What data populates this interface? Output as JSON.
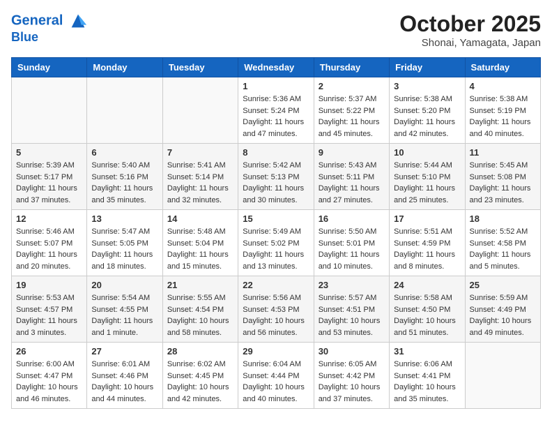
{
  "header": {
    "logo_line1": "General",
    "logo_line2": "Blue",
    "title": "October 2025",
    "subtitle": "Shonai, Yamagata, Japan"
  },
  "calendar": {
    "weekdays": [
      "Sunday",
      "Monday",
      "Tuesday",
      "Wednesday",
      "Thursday",
      "Friday",
      "Saturday"
    ],
    "rows": [
      [
        {
          "day": "",
          "info": ""
        },
        {
          "day": "",
          "info": ""
        },
        {
          "day": "",
          "info": ""
        },
        {
          "day": "1",
          "info": "Sunrise: 5:36 AM\nSunset: 5:24 PM\nDaylight: 11 hours and 47 minutes."
        },
        {
          "day": "2",
          "info": "Sunrise: 5:37 AM\nSunset: 5:22 PM\nDaylight: 11 hours and 45 minutes."
        },
        {
          "day": "3",
          "info": "Sunrise: 5:38 AM\nSunset: 5:20 PM\nDaylight: 11 hours and 42 minutes."
        },
        {
          "day": "4",
          "info": "Sunrise: 5:38 AM\nSunset: 5:19 PM\nDaylight: 11 hours and 40 minutes."
        }
      ],
      [
        {
          "day": "5",
          "info": "Sunrise: 5:39 AM\nSunset: 5:17 PM\nDaylight: 11 hours and 37 minutes."
        },
        {
          "day": "6",
          "info": "Sunrise: 5:40 AM\nSunset: 5:16 PM\nDaylight: 11 hours and 35 minutes."
        },
        {
          "day": "7",
          "info": "Sunrise: 5:41 AM\nSunset: 5:14 PM\nDaylight: 11 hours and 32 minutes."
        },
        {
          "day": "8",
          "info": "Sunrise: 5:42 AM\nSunset: 5:13 PM\nDaylight: 11 hours and 30 minutes."
        },
        {
          "day": "9",
          "info": "Sunrise: 5:43 AM\nSunset: 5:11 PM\nDaylight: 11 hours and 27 minutes."
        },
        {
          "day": "10",
          "info": "Sunrise: 5:44 AM\nSunset: 5:10 PM\nDaylight: 11 hours and 25 minutes."
        },
        {
          "day": "11",
          "info": "Sunrise: 5:45 AM\nSunset: 5:08 PM\nDaylight: 11 hours and 23 minutes."
        }
      ],
      [
        {
          "day": "12",
          "info": "Sunrise: 5:46 AM\nSunset: 5:07 PM\nDaylight: 11 hours and 20 minutes."
        },
        {
          "day": "13",
          "info": "Sunrise: 5:47 AM\nSunset: 5:05 PM\nDaylight: 11 hours and 18 minutes."
        },
        {
          "day": "14",
          "info": "Sunrise: 5:48 AM\nSunset: 5:04 PM\nDaylight: 11 hours and 15 minutes."
        },
        {
          "day": "15",
          "info": "Sunrise: 5:49 AM\nSunset: 5:02 PM\nDaylight: 11 hours and 13 minutes."
        },
        {
          "day": "16",
          "info": "Sunrise: 5:50 AM\nSunset: 5:01 PM\nDaylight: 11 hours and 10 minutes."
        },
        {
          "day": "17",
          "info": "Sunrise: 5:51 AM\nSunset: 4:59 PM\nDaylight: 11 hours and 8 minutes."
        },
        {
          "day": "18",
          "info": "Sunrise: 5:52 AM\nSunset: 4:58 PM\nDaylight: 11 hours and 5 minutes."
        }
      ],
      [
        {
          "day": "19",
          "info": "Sunrise: 5:53 AM\nSunset: 4:57 PM\nDaylight: 11 hours and 3 minutes."
        },
        {
          "day": "20",
          "info": "Sunrise: 5:54 AM\nSunset: 4:55 PM\nDaylight: 11 hours and 1 minute."
        },
        {
          "day": "21",
          "info": "Sunrise: 5:55 AM\nSunset: 4:54 PM\nDaylight: 10 hours and 58 minutes."
        },
        {
          "day": "22",
          "info": "Sunrise: 5:56 AM\nSunset: 4:53 PM\nDaylight: 10 hours and 56 minutes."
        },
        {
          "day": "23",
          "info": "Sunrise: 5:57 AM\nSunset: 4:51 PM\nDaylight: 10 hours and 53 minutes."
        },
        {
          "day": "24",
          "info": "Sunrise: 5:58 AM\nSunset: 4:50 PM\nDaylight: 10 hours and 51 minutes."
        },
        {
          "day": "25",
          "info": "Sunrise: 5:59 AM\nSunset: 4:49 PM\nDaylight: 10 hours and 49 minutes."
        }
      ],
      [
        {
          "day": "26",
          "info": "Sunrise: 6:00 AM\nSunset: 4:47 PM\nDaylight: 10 hours and 46 minutes."
        },
        {
          "day": "27",
          "info": "Sunrise: 6:01 AM\nSunset: 4:46 PM\nDaylight: 10 hours and 44 minutes."
        },
        {
          "day": "28",
          "info": "Sunrise: 6:02 AM\nSunset: 4:45 PM\nDaylight: 10 hours and 42 minutes."
        },
        {
          "day": "29",
          "info": "Sunrise: 6:04 AM\nSunset: 4:44 PM\nDaylight: 10 hours and 40 minutes."
        },
        {
          "day": "30",
          "info": "Sunrise: 6:05 AM\nSunset: 4:42 PM\nDaylight: 10 hours and 37 minutes."
        },
        {
          "day": "31",
          "info": "Sunrise: 6:06 AM\nSunset: 4:41 PM\nDaylight: 10 hours and 35 minutes."
        },
        {
          "day": "",
          "info": ""
        }
      ]
    ]
  }
}
